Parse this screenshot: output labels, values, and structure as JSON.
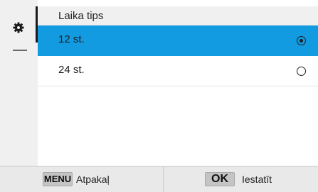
{
  "header": {
    "title": "Laika tips"
  },
  "sidebar": {
    "icon": "gear-icon"
  },
  "options": [
    {
      "label": "12 st.",
      "selected": true
    },
    {
      "label": "24 st.",
      "selected": false
    }
  ],
  "footer": {
    "menu_key": "MENU",
    "back_label": "Atpakaļ",
    "ok_key": "OK",
    "set_label": "Iestatīt"
  },
  "colors": {
    "selection": "#129be0",
    "panel": "#f0f0f0",
    "footer": "#e9e9e9"
  }
}
